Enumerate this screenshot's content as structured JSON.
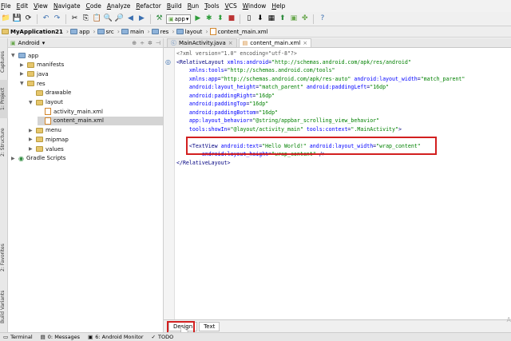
{
  "menubar": [
    "File",
    "Edit",
    "View",
    "Navigate",
    "Code",
    "Analyze",
    "Refactor",
    "Build",
    "Run",
    "Tools",
    "VCS",
    "Window",
    "Help"
  ],
  "toolbar": {
    "run_config": "app"
  },
  "breadcrumb": [
    "MyApplication21",
    "app",
    "src",
    "main",
    "res",
    "layout",
    "content_main.xml"
  ],
  "left_tabs": {
    "captures": "Captures",
    "project": "1: Project",
    "structure": "2: Structure",
    "favorites": "2: Favorites",
    "build_variants": "Build Variants"
  },
  "project_panel": {
    "view": "Android"
  },
  "tree": [
    {
      "label": "app",
      "indent": 0,
      "type": "folder-blue",
      "twisty": "▼"
    },
    {
      "label": "manifests",
      "indent": 1,
      "type": "folder",
      "twisty": "▶"
    },
    {
      "label": "java",
      "indent": 1,
      "type": "folder",
      "twisty": "▶"
    },
    {
      "label": "res",
      "indent": 1,
      "type": "folder",
      "twisty": "▼"
    },
    {
      "label": "drawable",
      "indent": 2,
      "type": "folder",
      "twisty": ""
    },
    {
      "label": "layout",
      "indent": 2,
      "type": "folder",
      "twisty": "▼"
    },
    {
      "label": "activity_main.xml",
      "indent": 3,
      "type": "xml",
      "twisty": ""
    },
    {
      "label": "content_main.xml",
      "indent": 3,
      "type": "xml",
      "twisty": "",
      "selected": true
    },
    {
      "label": "menu",
      "indent": 2,
      "type": "folder",
      "twisty": "▶"
    },
    {
      "label": "mipmap",
      "indent": 2,
      "type": "folder",
      "twisty": "▶"
    },
    {
      "label": "values",
      "indent": 2,
      "type": "folder",
      "twisty": "▶"
    },
    {
      "label": "Gradle Scripts",
      "indent": 0,
      "type": "gradle",
      "twisty": "▶"
    }
  ],
  "editor_tabs": [
    {
      "label": "MainActivity.java",
      "active": false
    },
    {
      "label": "content_main.xml",
      "active": true
    }
  ],
  "code_lines": [
    "<?xml version=\"1.0\" encoding=\"utf-8\"?>",
    "<RelativeLayout xmlns:android=\"http://schemas.android.com/apk/res/android\"",
    "    xmlns:tools=\"http://schemas.android.com/tools\"",
    "    xmlns:app=\"http://schemas.android.com/apk/res-auto\" android:layout_width=\"match_parent\"",
    "    android:layout_height=\"match_parent\" android:paddingLeft=\"16dp\"",
    "    android:paddingRight=\"16dp\"",
    "    android:paddingTop=\"16dp\"",
    "    android:paddingBottom=\"16dp\"",
    "    app:layout_behavior=\"@string/appbar_scrolling_view_behavior\"",
    "    tools:showIn=\"@layout/activity_main\" tools:context=\".MainActivity\">",
    "",
    "    <TextView android:text=\"Hello World!\" android:layout_width=\"wrap_content\"",
    "        android:layout_height=\"wrap_content\" />",
    "</RelativeLayout>"
  ],
  "design_tabs": [
    "Design",
    "Text"
  ],
  "bottom_tools": [
    "Terminal",
    "0: Messages",
    "6: Android Monitor",
    "TODO"
  ],
  "watermark": "A",
  "colors": {
    "highlight": "#d21f1f",
    "selection": "#d4d4d4"
  }
}
